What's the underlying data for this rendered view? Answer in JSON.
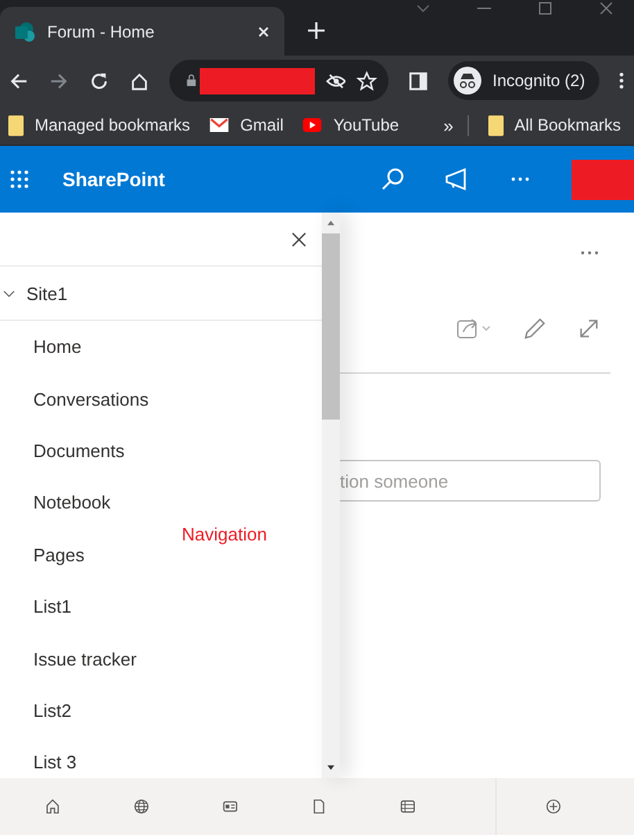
{
  "browser": {
    "tab": {
      "title": "Forum - Home"
    },
    "profile": {
      "label": "Incognito (2)"
    },
    "bookmarks": [
      {
        "label": "Managed bookmarks",
        "kind": "folder"
      },
      {
        "label": "Gmail",
        "kind": "gmail"
      },
      {
        "label": "YouTube",
        "kind": "youtube"
      }
    ],
    "overflow": "»",
    "all_bookmarks": "All Bookmarks"
  },
  "app": {
    "title": "SharePoint"
  },
  "navigation": {
    "site": {
      "label": "Site1",
      "expanded": true
    },
    "items": [
      {
        "label": "Home"
      },
      {
        "label": "Conversations"
      },
      {
        "label": "Documents"
      },
      {
        "label": "Notebook"
      },
      {
        "label": "Pages"
      },
      {
        "label": "List1"
      },
      {
        "label": "Issue tracker"
      },
      {
        "label": "List2"
      },
      {
        "label": "List 3"
      }
    ]
  },
  "annotation": "Navigation",
  "content": {
    "mention_field": {
      "placeholder": "tion someone"
    }
  }
}
